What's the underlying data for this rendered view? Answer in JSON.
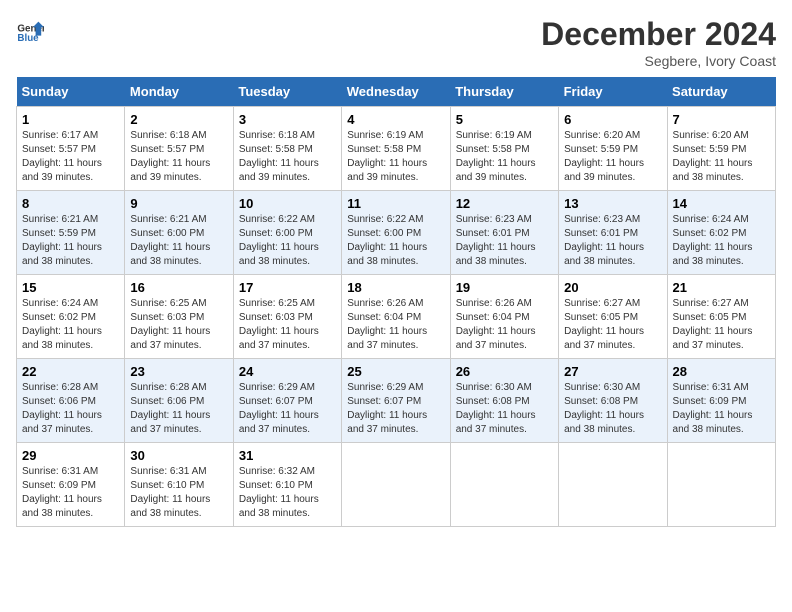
{
  "header": {
    "logo_line1": "General",
    "logo_line2": "Blue",
    "main_title": "December 2024",
    "subtitle": "Segbere, Ivory Coast"
  },
  "days_of_week": [
    "Sunday",
    "Monday",
    "Tuesday",
    "Wednesday",
    "Thursday",
    "Friday",
    "Saturday"
  ],
  "weeks": [
    [
      {
        "day": "1",
        "sunrise": "Sunrise: 6:17 AM",
        "sunset": "Sunset: 5:57 PM",
        "daylight": "Daylight: 11 hours and 39 minutes."
      },
      {
        "day": "2",
        "sunrise": "Sunrise: 6:18 AM",
        "sunset": "Sunset: 5:57 PM",
        "daylight": "Daylight: 11 hours and 39 minutes."
      },
      {
        "day": "3",
        "sunrise": "Sunrise: 6:18 AM",
        "sunset": "Sunset: 5:58 PM",
        "daylight": "Daylight: 11 hours and 39 minutes."
      },
      {
        "day": "4",
        "sunrise": "Sunrise: 6:19 AM",
        "sunset": "Sunset: 5:58 PM",
        "daylight": "Daylight: 11 hours and 39 minutes."
      },
      {
        "day": "5",
        "sunrise": "Sunrise: 6:19 AM",
        "sunset": "Sunset: 5:58 PM",
        "daylight": "Daylight: 11 hours and 39 minutes."
      },
      {
        "day": "6",
        "sunrise": "Sunrise: 6:20 AM",
        "sunset": "Sunset: 5:59 PM",
        "daylight": "Daylight: 11 hours and 39 minutes."
      },
      {
        "day": "7",
        "sunrise": "Sunrise: 6:20 AM",
        "sunset": "Sunset: 5:59 PM",
        "daylight": "Daylight: 11 hours and 38 minutes."
      }
    ],
    [
      {
        "day": "8",
        "sunrise": "Sunrise: 6:21 AM",
        "sunset": "Sunset: 5:59 PM",
        "daylight": "Daylight: 11 hours and 38 minutes."
      },
      {
        "day": "9",
        "sunrise": "Sunrise: 6:21 AM",
        "sunset": "Sunset: 6:00 PM",
        "daylight": "Daylight: 11 hours and 38 minutes."
      },
      {
        "day": "10",
        "sunrise": "Sunrise: 6:22 AM",
        "sunset": "Sunset: 6:00 PM",
        "daylight": "Daylight: 11 hours and 38 minutes."
      },
      {
        "day": "11",
        "sunrise": "Sunrise: 6:22 AM",
        "sunset": "Sunset: 6:00 PM",
        "daylight": "Daylight: 11 hours and 38 minutes."
      },
      {
        "day": "12",
        "sunrise": "Sunrise: 6:23 AM",
        "sunset": "Sunset: 6:01 PM",
        "daylight": "Daylight: 11 hours and 38 minutes."
      },
      {
        "day": "13",
        "sunrise": "Sunrise: 6:23 AM",
        "sunset": "Sunset: 6:01 PM",
        "daylight": "Daylight: 11 hours and 38 minutes."
      },
      {
        "day": "14",
        "sunrise": "Sunrise: 6:24 AM",
        "sunset": "Sunset: 6:02 PM",
        "daylight": "Daylight: 11 hours and 38 minutes."
      }
    ],
    [
      {
        "day": "15",
        "sunrise": "Sunrise: 6:24 AM",
        "sunset": "Sunset: 6:02 PM",
        "daylight": "Daylight: 11 hours and 38 minutes."
      },
      {
        "day": "16",
        "sunrise": "Sunrise: 6:25 AM",
        "sunset": "Sunset: 6:03 PM",
        "daylight": "Daylight: 11 hours and 37 minutes."
      },
      {
        "day": "17",
        "sunrise": "Sunrise: 6:25 AM",
        "sunset": "Sunset: 6:03 PM",
        "daylight": "Daylight: 11 hours and 37 minutes."
      },
      {
        "day": "18",
        "sunrise": "Sunrise: 6:26 AM",
        "sunset": "Sunset: 6:04 PM",
        "daylight": "Daylight: 11 hours and 37 minutes."
      },
      {
        "day": "19",
        "sunrise": "Sunrise: 6:26 AM",
        "sunset": "Sunset: 6:04 PM",
        "daylight": "Daylight: 11 hours and 37 minutes."
      },
      {
        "day": "20",
        "sunrise": "Sunrise: 6:27 AM",
        "sunset": "Sunset: 6:05 PM",
        "daylight": "Daylight: 11 hours and 37 minutes."
      },
      {
        "day": "21",
        "sunrise": "Sunrise: 6:27 AM",
        "sunset": "Sunset: 6:05 PM",
        "daylight": "Daylight: 11 hours and 37 minutes."
      }
    ],
    [
      {
        "day": "22",
        "sunrise": "Sunrise: 6:28 AM",
        "sunset": "Sunset: 6:06 PM",
        "daylight": "Daylight: 11 hours and 37 minutes."
      },
      {
        "day": "23",
        "sunrise": "Sunrise: 6:28 AM",
        "sunset": "Sunset: 6:06 PM",
        "daylight": "Daylight: 11 hours and 37 minutes."
      },
      {
        "day": "24",
        "sunrise": "Sunrise: 6:29 AM",
        "sunset": "Sunset: 6:07 PM",
        "daylight": "Daylight: 11 hours and 37 minutes."
      },
      {
        "day": "25",
        "sunrise": "Sunrise: 6:29 AM",
        "sunset": "Sunset: 6:07 PM",
        "daylight": "Daylight: 11 hours and 37 minutes."
      },
      {
        "day": "26",
        "sunrise": "Sunrise: 6:30 AM",
        "sunset": "Sunset: 6:08 PM",
        "daylight": "Daylight: 11 hours and 37 minutes."
      },
      {
        "day": "27",
        "sunrise": "Sunrise: 6:30 AM",
        "sunset": "Sunset: 6:08 PM",
        "daylight": "Daylight: 11 hours and 38 minutes."
      },
      {
        "day": "28",
        "sunrise": "Sunrise: 6:31 AM",
        "sunset": "Sunset: 6:09 PM",
        "daylight": "Daylight: 11 hours and 38 minutes."
      }
    ],
    [
      {
        "day": "29",
        "sunrise": "Sunrise: 6:31 AM",
        "sunset": "Sunset: 6:09 PM",
        "daylight": "Daylight: 11 hours and 38 minutes."
      },
      {
        "day": "30",
        "sunrise": "Sunrise: 6:31 AM",
        "sunset": "Sunset: 6:10 PM",
        "daylight": "Daylight: 11 hours and 38 minutes."
      },
      {
        "day": "31",
        "sunrise": "Sunrise: 6:32 AM",
        "sunset": "Sunset: 6:10 PM",
        "daylight": "Daylight: 11 hours and 38 minutes."
      },
      null,
      null,
      null,
      null
    ]
  ]
}
